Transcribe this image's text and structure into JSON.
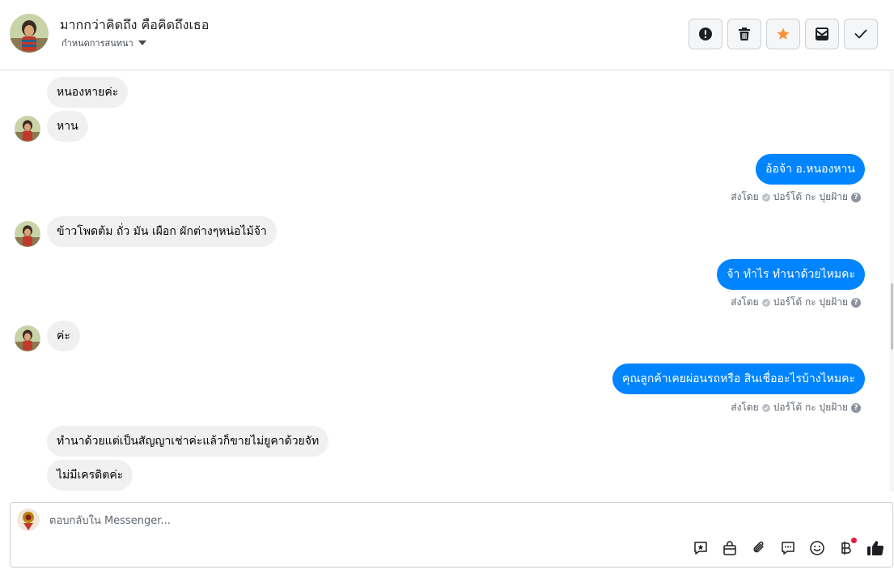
{
  "header": {
    "contact_name": "มากกว่าคิดถึง คือคิดถึงเธอ",
    "assign_label": "กำหนดการสนทนา",
    "actions": [
      {
        "icon": "exclamation-icon"
      },
      {
        "icon": "trash-icon"
      },
      {
        "icon": "star-icon",
        "color": "#f7923b"
      },
      {
        "icon": "mark-unread-icon"
      },
      {
        "icon": "check-icon"
      }
    ]
  },
  "messages": {
    "m1": "หนองหายค่ะ",
    "m2": "หาน",
    "m3": "อ้อจ้า อ.หนองหาน",
    "m4": "ข้าวโพดต้ม ถั่ว มัน เผือก ผักต่างๆหน่อไม้จ้า",
    "m5": "จ้า ทำไร ทำนาด้วยไหมคะ",
    "m6": "ค่ะ",
    "m7": "คุณลูกค้าเคยผ่อนรถหรือ สินเชื่ออะไรบ้างไหมคะ",
    "m8": "ทำนาด้วยแต่เป็นสัญญาเช่าค่ะแล้วก็ขายไม่ยูคาด้วยจัท",
    "m9": "ไม่มีเครดิตค่ะ"
  },
  "sent_by": {
    "label": "ส่งโดย",
    "name": "ปอร์โต้ กะ ปุยฝ้าย",
    "help": "?"
  },
  "composer": {
    "placeholder": "ตอบกลับใน Messenger...",
    "tools": [
      "saved-reply-icon",
      "shop-bag-icon",
      "paperclip-icon",
      "chat-bubble-icon",
      "emoji-icon",
      "baht-payment-icon",
      "thumbs-up-icon"
    ]
  },
  "colors": {
    "outgoing": "#0084ff",
    "incoming": "#f0f0f0",
    "star": "#f7923b",
    "notification": "#e41e3f"
  }
}
